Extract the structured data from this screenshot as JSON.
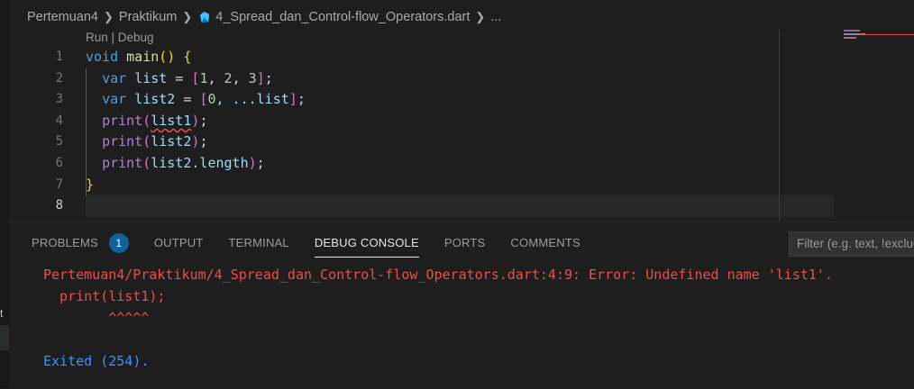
{
  "breadcrumb": {
    "items": [
      "Pertemuan4",
      "Praktikum",
      "4_Spread_dan_Control-flow_Operators.dart",
      "..."
    ]
  },
  "editor": {
    "codelens": "Run | Debug",
    "line_numbers": [
      "1",
      "2",
      "3",
      "4",
      "5",
      "6",
      "7",
      "8"
    ],
    "active_line": "8",
    "code": {
      "l1": {
        "kw": "void",
        "fn": "main",
        "open": "()",
        "brace": " {"
      },
      "l2": {
        "kw": "var",
        "name": "list",
        "eq": " = ",
        "ob": "[",
        "n1": "1",
        "c1": ", ",
        "n2": "2",
        "c2": ", ",
        "n3": "3",
        "cb": "]",
        "semi": ";"
      },
      "l3": {
        "kw": "var",
        "name": "list2",
        "eq": " = ",
        "ob": "[",
        "n1": "0",
        "rest": ", ...list",
        "cb": "]",
        "semi": ";"
      },
      "l4": {
        "fn": "print",
        "op": "(",
        "arg": "list1",
        "cp": ")",
        "semi": ";"
      },
      "l5": {
        "fn": "print",
        "op": "(",
        "arg": "list2",
        "cp": ")",
        "semi": ";"
      },
      "l6": {
        "fn": "print",
        "op": "(",
        "arg": "list2.length",
        "cp": ")",
        "semi": ";"
      },
      "l7": {
        "close": "}"
      }
    }
  },
  "panel": {
    "tabs": [
      "PROBLEMS",
      "OUTPUT",
      "TERMINAL",
      "DEBUG CONSOLE",
      "PORTS",
      "COMMENTS"
    ],
    "active_tab": "DEBUG CONSOLE",
    "problems_count": "1",
    "filter_placeholder": "Filter (e.g. text, !exclude)",
    "console": {
      "error_line": "Pertemuan4/Praktikum/4_Spread_dan_Control-flow_Operators.dart:4:9: Error: Undefined name 'list1'.",
      "code_line": "  print(list1);",
      "caret_line": "        ^^^^^",
      "exit_line": "Exited (254)."
    }
  },
  "left_strip": {
    "glyph": "t"
  },
  "colors": {
    "error": "#f14c4c",
    "info": "#3794ff",
    "accent": "#0e639c"
  },
  "icons": [
    "dart-icon",
    "chevron-right-icon"
  ]
}
